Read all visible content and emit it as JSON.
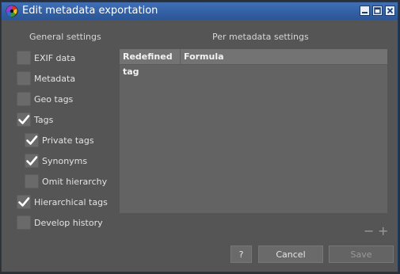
{
  "window": {
    "title": "Edit metadata exportation"
  },
  "general": {
    "heading": "General settings",
    "items": [
      {
        "label": "EXIF data",
        "checked": false
      },
      {
        "label": "Metadata",
        "checked": false
      },
      {
        "label": "Geo tags",
        "checked": false
      },
      {
        "label": "Tags",
        "checked": true
      },
      {
        "label": "Private tags",
        "checked": true
      },
      {
        "label": "Synonyms",
        "checked": true
      },
      {
        "label": "Omit hierarchy",
        "checked": false
      },
      {
        "label": "Hierarchical tags",
        "checked": true
      },
      {
        "label": "Develop history",
        "checked": false
      }
    ]
  },
  "per_metadata": {
    "heading": "Per metadata settings",
    "columns": [
      "Redefined tag",
      "Formula"
    ]
  },
  "controls": {
    "minus": "−",
    "plus": "+"
  },
  "buttons": {
    "help": "?",
    "cancel": "Cancel",
    "save": "Save"
  }
}
